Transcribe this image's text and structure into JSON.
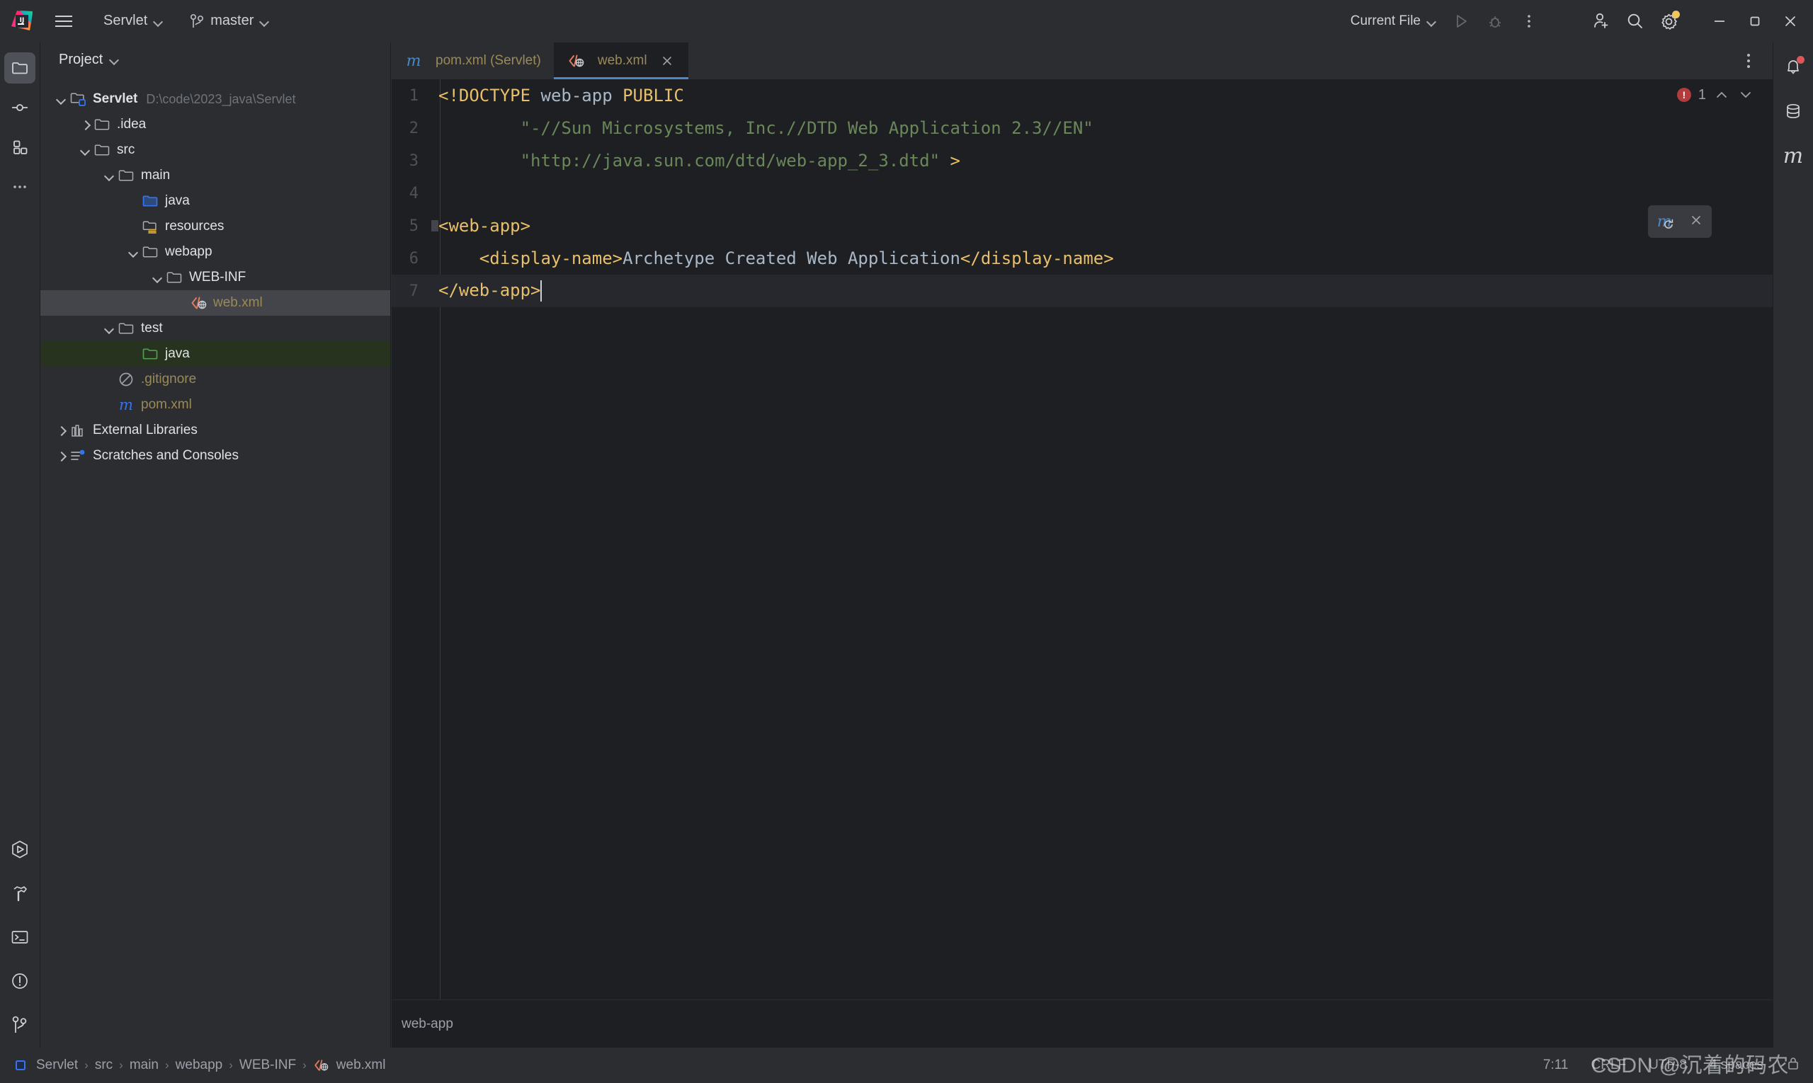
{
  "titlebar": {
    "project_name": "Servlet",
    "branch": "master",
    "run_config": "Current File",
    "icons": {
      "logo": "intellij-idea-logo",
      "menu": "hamburger-menu-icon",
      "vcs": "branch-icon",
      "run": "run-icon",
      "debug": "debug-icon",
      "more": "more-vertical-icon",
      "account": "add-account-icon",
      "search": "search-icon",
      "settings": "gear-icon",
      "minimize": "minimize-icon",
      "maximize": "maximize-icon",
      "close": "close-icon"
    }
  },
  "left_strip": {
    "top": [
      {
        "name": "project-tool-window",
        "icon": "folder-icon",
        "active": true
      },
      {
        "name": "commit-tool-window",
        "icon": "commit-icon",
        "active": false
      },
      {
        "name": "structure-tool-window",
        "icon": "structure-icon",
        "active": false
      },
      {
        "name": "more-tool-windows",
        "icon": "more-horizontal-icon",
        "active": false
      }
    ],
    "bottom": [
      {
        "name": "run-tool-window",
        "icon": "run-hex-icon"
      },
      {
        "name": "build-tool-window",
        "icon": "hammer-icon"
      },
      {
        "name": "terminal-tool-window",
        "icon": "terminal-icon"
      },
      {
        "name": "problems-tool-window",
        "icon": "warning-circle-icon"
      },
      {
        "name": "version-control-tool-window",
        "icon": "branch-icon"
      }
    ]
  },
  "right_strip": [
    {
      "name": "notifications",
      "icon": "bell-icon",
      "badge": true
    },
    {
      "name": "database-tool-window",
      "icon": "database-icon"
    },
    {
      "name": "maven-tool-window",
      "icon": "maven-m-icon"
    }
  ],
  "project_panel": {
    "title": "Project",
    "tree": [
      {
        "id": "servlet",
        "label": "Servlet",
        "path": "D:\\code\\2023_java\\Servlet",
        "depth": 0,
        "arrow": "down",
        "icon": "module-folder-icon",
        "bold": true,
        "state": "none"
      },
      {
        "id": "idea",
        "label": ".idea",
        "path": "",
        "depth": 1,
        "arrow": "right",
        "icon": "folder-icon",
        "bold": false,
        "state": "none"
      },
      {
        "id": "src",
        "label": "src",
        "path": "",
        "depth": 1,
        "arrow": "down",
        "icon": "folder-icon",
        "bold": false,
        "state": "none"
      },
      {
        "id": "main",
        "label": "main",
        "path": "",
        "depth": 2,
        "arrow": "down",
        "icon": "folder-icon",
        "bold": false,
        "state": "none"
      },
      {
        "id": "main-java",
        "label": "java",
        "path": "",
        "depth": 3,
        "arrow": "none",
        "icon": "source-folder-blue-icon",
        "bold": false,
        "state": "none"
      },
      {
        "id": "resources",
        "label": "resources",
        "path": "",
        "depth": 3,
        "arrow": "none",
        "icon": "resources-folder-icon",
        "bold": false,
        "state": "none"
      },
      {
        "id": "webapp",
        "label": "webapp",
        "path": "",
        "depth": 3,
        "arrow": "down",
        "icon": "folder-icon",
        "bold": false,
        "state": "none"
      },
      {
        "id": "webinf",
        "label": "WEB-INF",
        "path": "",
        "depth": 4,
        "arrow": "down",
        "icon": "folder-icon",
        "bold": false,
        "state": "none"
      },
      {
        "id": "webxml",
        "label": "web.xml",
        "path": "",
        "depth": 5,
        "arrow": "none",
        "icon": "xml-file-icon",
        "bold": false,
        "state": "selected"
      },
      {
        "id": "test",
        "label": "test",
        "path": "",
        "depth": 2,
        "arrow": "down",
        "icon": "folder-icon",
        "bold": false,
        "state": "none"
      },
      {
        "id": "test-java",
        "label": "java",
        "path": "",
        "depth": 3,
        "arrow": "none",
        "icon": "test-folder-green-icon",
        "bold": false,
        "state": "green"
      },
      {
        "id": "gitignore",
        "label": ".gitignore",
        "path": "",
        "depth": 2,
        "arrow": "none",
        "icon": "gitignore-icon",
        "bold": false,
        "state": "none"
      },
      {
        "id": "pomxml",
        "label": "pom.xml",
        "path": "",
        "depth": 2,
        "arrow": "none",
        "icon": "maven-m-icon",
        "bold": false,
        "state": "none"
      },
      {
        "id": "extlibs",
        "label": "External Libraries",
        "path": "",
        "depth": 0,
        "arrow": "right",
        "icon": "library-icon",
        "bold": false,
        "state": "none"
      },
      {
        "id": "scratches",
        "label": "Scratches and Consoles",
        "path": "",
        "depth": 0,
        "arrow": "right",
        "icon": "scratches-icon",
        "bold": false,
        "state": "none"
      }
    ]
  },
  "editor": {
    "tabs": [
      {
        "label": "pom.xml (Servlet)",
        "icon": "maven-m-icon",
        "active": false,
        "closable": false
      },
      {
        "label": "web.xml",
        "icon": "xml-file-icon",
        "active": true,
        "closable": true
      }
    ],
    "error_count": "1",
    "error_icon": "error-circle-icon",
    "maven_popup": {
      "reload_icon": "maven-reload-icon",
      "close_icon": "close-icon"
    },
    "breadcrumb": "web-app",
    "lines": [
      {
        "num": "1",
        "caret": false,
        "tokens": [
          {
            "t": "<!DOCTYPE ",
            "c": "tag"
          },
          {
            "t": "web-app",
            "c": "name"
          },
          {
            "t": " PUBLIC",
            "c": "tag"
          }
        ]
      },
      {
        "num": "2",
        "caret": false,
        "tokens": [
          {
            "t": "        \"-//Sun Microsystems, Inc.//DTD Web Application 2.3//EN\"",
            "c": "str"
          }
        ]
      },
      {
        "num": "3",
        "caret": false,
        "tokens": [
          {
            "t": "        \"http://java.sun.com/dtd/web-app_2_3.dtd\"",
            "c": "str"
          },
          {
            "t": " >",
            "c": "tag"
          }
        ]
      },
      {
        "num": "4",
        "caret": false,
        "tokens": []
      },
      {
        "num": "5",
        "caret": false,
        "fold": true,
        "tokens": [
          {
            "t": "<web-app>",
            "c": "tag"
          }
        ]
      },
      {
        "num": "6",
        "caret": false,
        "tokens": [
          {
            "t": "    <display-name>",
            "c": "tag"
          },
          {
            "t": "Archetype Created Web Application",
            "c": "txt"
          },
          {
            "t": "</display-name>",
            "c": "tag"
          }
        ]
      },
      {
        "num": "7",
        "caret": true,
        "tokens": [
          {
            "t": "</web-app>",
            "c": "tag"
          }
        ]
      }
    ]
  },
  "statusbar": {
    "crumbs": [
      {
        "label": "Servlet",
        "icon": "module-icon"
      },
      {
        "label": "src",
        "icon": ""
      },
      {
        "label": "main",
        "icon": ""
      },
      {
        "label": "webapp",
        "icon": ""
      },
      {
        "label": "WEB-INF",
        "icon": ""
      },
      {
        "label": "web.xml",
        "icon": "xml-file-icon"
      }
    ],
    "separator": "›",
    "caret_position": "7:11",
    "line_separator": "CRLF",
    "encoding": "UTF-8",
    "indent": "4 spaces",
    "lock_icon": "lock-icon"
  },
  "watermark": "CSDN @沉着的码农",
  "colors": {
    "bg_panel": "#2b2d30",
    "bg_editor": "#1e1f22",
    "accent_blue": "#4a88c7",
    "tag_yellow": "#e8bf6a",
    "string_green": "#6a8759",
    "file_yellow": "#9a8a56",
    "error_red": "#b33b3b",
    "badge_yellow": "#f2c55c",
    "selection_gray": "#43454a",
    "selection_green": "#27331f"
  }
}
